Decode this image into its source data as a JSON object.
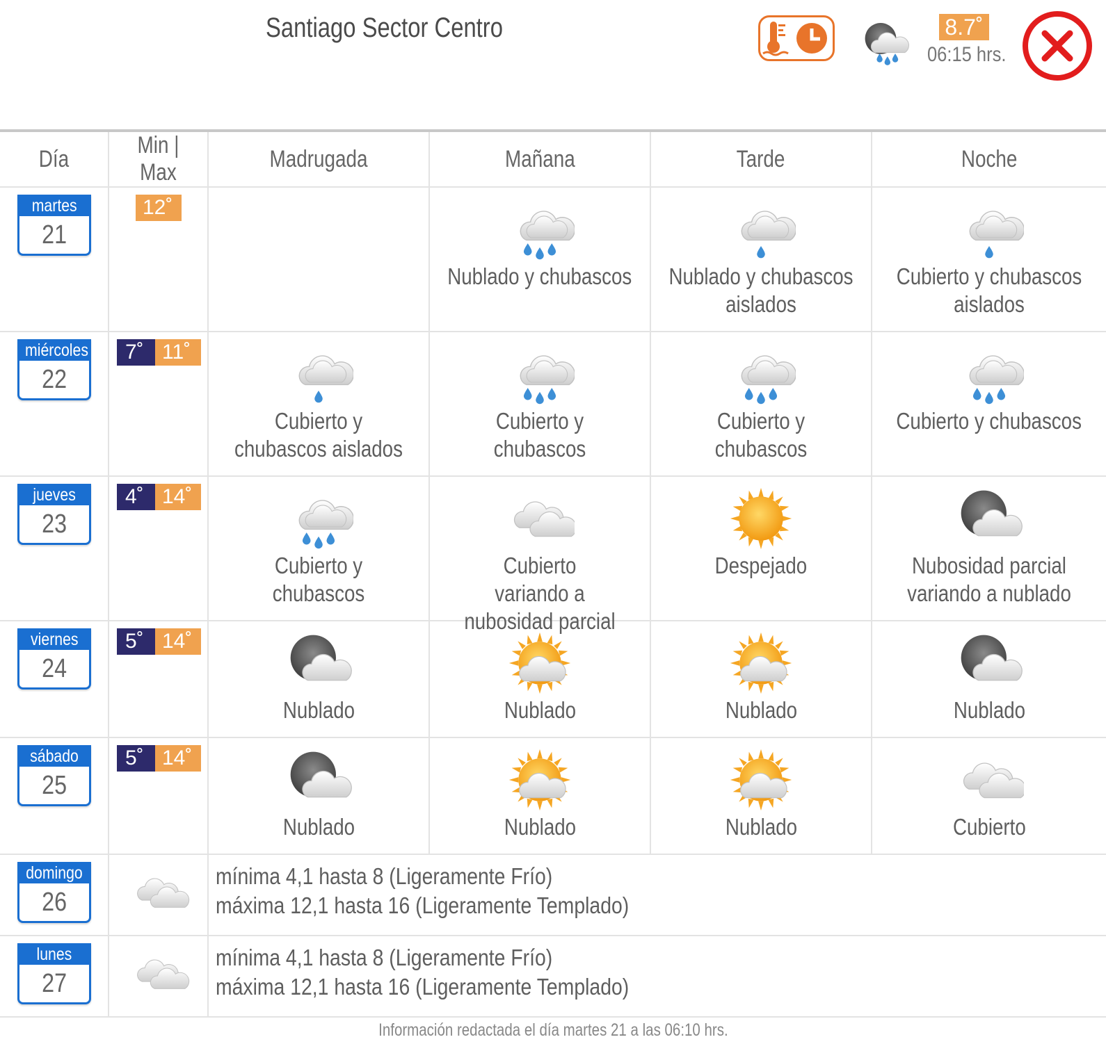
{
  "header": {
    "title": "Santiago Sector Centro",
    "current_temp": "8.7˚",
    "current_time": "06:15 hrs.",
    "colors": {
      "accent_orange": "#f0a24f",
      "close_red": "#e21d1d",
      "day_blue": "#1a6fd1",
      "min_navy": "#2d2a6b"
    }
  },
  "table": {
    "headers": {
      "day": "Día",
      "minmax": "Min | Max",
      "madrugada": "Madrugada",
      "manana": "Mañana",
      "tarde": "Tarde",
      "noche": "Noche"
    },
    "rows": [
      {
        "day": "martes",
        "num": "21",
        "min": "",
        "max": "12˚",
        "madrugada": {
          "icon": "",
          "desc": ""
        },
        "manana": {
          "icon": "cloud-rain-icon",
          "desc": "Nublado y chubascos"
        },
        "tarde": {
          "icon": "cloud-drizzle-icon",
          "desc": "Nublado y chubascos aislados"
        },
        "noche": {
          "icon": "cloud-drizzle-icon",
          "desc": "Cubierto y chubascos aislados"
        }
      },
      {
        "day": "miércoles",
        "num": "22",
        "min": "7˚",
        "max": "11˚",
        "madrugada": {
          "icon": "cloud-drizzle-icon",
          "desc": "Cubierto y chubascos aislados"
        },
        "manana": {
          "icon": "cloud-rain-icon",
          "desc": "Cubierto y chubascos"
        },
        "tarde": {
          "icon": "cloud-rain-icon",
          "desc": "Cubierto y chubascos"
        },
        "noche": {
          "icon": "cloud-rain-icon",
          "desc": "Cubierto y chubascos"
        }
      },
      {
        "day": "jueves",
        "num": "23",
        "min": "4˚",
        "max": "14˚",
        "madrugada": {
          "icon": "cloud-rain-icon",
          "desc": "Cubierto y chubascos"
        },
        "manana": {
          "icon": "overcast-icon",
          "desc": "Cubierto variando a nubosidad parcial"
        },
        "tarde": {
          "icon": "sun-icon",
          "desc": "Despejado"
        },
        "noche": {
          "icon": "moon-cloud-icon",
          "desc": "Nubosidad parcial variando a nublado"
        }
      },
      {
        "day": "viernes",
        "num": "24",
        "min": "5˚",
        "max": "14˚",
        "madrugada": {
          "icon": "moon-cloud-icon",
          "desc": "Nublado"
        },
        "manana": {
          "icon": "sun-cloud-icon",
          "desc": "Nublado"
        },
        "tarde": {
          "icon": "sun-cloud-icon",
          "desc": "Nublado"
        },
        "noche": {
          "icon": "moon-cloud-icon",
          "desc": "Nublado"
        }
      },
      {
        "day": "sábado",
        "num": "25",
        "min": "5˚",
        "max": "14˚",
        "madrugada": {
          "icon": "moon-cloud-icon",
          "desc": "Nublado"
        },
        "manana": {
          "icon": "sun-cloud-icon",
          "desc": "Nublado"
        },
        "tarde": {
          "icon": "sun-cloud-icon",
          "desc": "Nublado"
        },
        "noche": {
          "icon": "overcast-icon",
          "desc": "Cubierto"
        }
      }
    ],
    "extended": [
      {
        "day": "domingo",
        "num": "26",
        "icon": "overcast-icon",
        "line1": "mínima 4,1 hasta 8 (Ligeramente Frío)",
        "line2": "máxima 12,1 hasta 16 (Ligeramente Templado)"
      },
      {
        "day": "lunes",
        "num": "27",
        "icon": "overcast-icon",
        "line1": "mínima 4,1 hasta 8 (Ligeramente Frío)",
        "line2": "máxima 12,1 hasta 16 (Ligeramente Templado)"
      }
    ]
  },
  "footer": {
    "text": "Información redactada el día martes 21 a las 06:10 hrs."
  }
}
